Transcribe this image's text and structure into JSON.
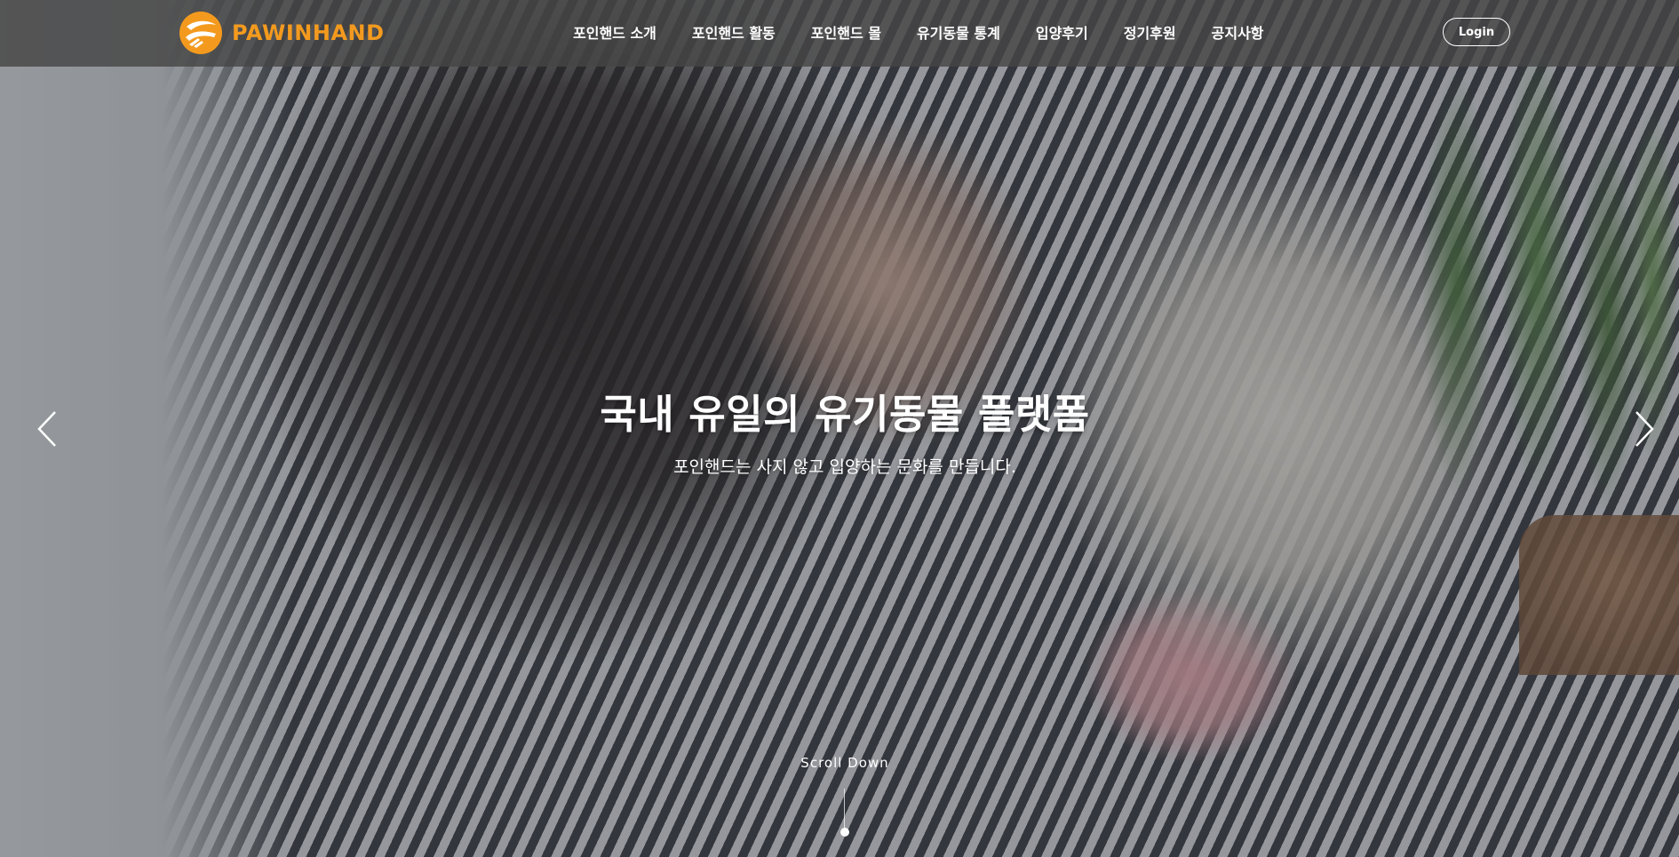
{
  "header": {
    "logo_text": "PAWINHAND",
    "logo_color": "#f39a1e",
    "nav": [
      {
        "label": "포인핸드 소개"
      },
      {
        "label": "포인핸드 활동"
      },
      {
        "label": "포인핸드 몰"
      },
      {
        "label": "유기동물 통계"
      },
      {
        "label": "입양후기"
      },
      {
        "label": "정기후원"
      },
      {
        "label": "공지사항"
      }
    ],
    "login_label": "Login"
  },
  "hero": {
    "title": "국내 유일의 유기동물 플랫폼",
    "subtitle": "포인핸드는 사지 않고 입양하는 문화를 만듭니다.",
    "prev_icon": "chevron-left-icon",
    "next_icon": "chevron-right-icon",
    "scroll_label": "Scroll Down"
  }
}
